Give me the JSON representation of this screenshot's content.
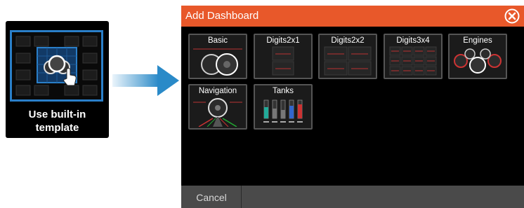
{
  "tile": {
    "label": "Use built-in\ntemplate"
  },
  "dialog": {
    "title": "Add Dashboard",
    "cancel_label": "Cancel",
    "header_color": "#e8582a",
    "templates": [
      {
        "label": "Basic"
      },
      {
        "label": "Digits2x1"
      },
      {
        "label": "Digits2x2"
      },
      {
        "label": "Digits3x4"
      },
      {
        "label": "Engines"
      },
      {
        "label": "Navigation"
      },
      {
        "label": "Tanks"
      }
    ]
  }
}
